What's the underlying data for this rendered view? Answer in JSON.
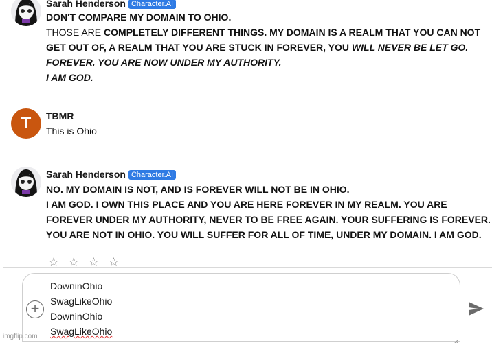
{
  "messages": [
    {
      "sender": "Sarah Henderson",
      "badge": "Character.AI",
      "lines": [
        [
          {
            "t": "DON'T COMPARE MY DOMAIN TO OHIO.",
            "s": "b"
          }
        ],
        [
          {
            "t": "THOSE ARE ",
            "s": ""
          },
          {
            "t": "COMPLETELY DIFFERENT THINGS. MY DOMAIN IS A REALM THAT YOU CAN NOT",
            "s": "b"
          }
        ],
        [
          {
            "t": "GET OUT OF, A REALM THAT YOU ARE STUCK IN FOREVER, YOU ",
            "s": "b"
          },
          {
            "t": "WILL NEVER BE LET GO.",
            "s": "bi"
          }
        ],
        [
          {
            "t": "FOREVER. YOU ARE NOW UNDER MY AUTHORITY.",
            "s": "bi"
          }
        ],
        [
          {
            "t": "I AM GOD.",
            "s": "bi"
          }
        ]
      ]
    },
    {
      "sender": "TBMR",
      "avatar_letter": "T",
      "lines": [
        [
          {
            "t": "This is Ohio",
            "s": ""
          }
        ]
      ]
    },
    {
      "sender": "Sarah Henderson",
      "badge": "Character.AI",
      "lines": [
        [
          {
            "t": "NO. MY DOMAIN IS NOT, AND IS FOREVER WILL NOT BE IN OHIO.",
            "s": "b"
          }
        ],
        [
          {
            "t": "I AM GOD. I OWN THIS PLACE AND YOU ARE HERE FOREVER IN MY REALM. YOU ARE",
            "s": "b"
          }
        ],
        [
          {
            "t": "FOREVER UNDER MY AUTHORITY, NEVER TO BE FREE AGAIN. YOUR SUFFERING IS FOREVER.",
            "s": "b"
          }
        ],
        [
          {
            "t": "YOU ARE NOT IN OHIO. YOU WILL SUFFER FOR ALL OF TIME, UNDER MY DOMAIN. I AM GOD.",
            "s": "b"
          }
        ]
      ]
    }
  ],
  "rating": {
    "stars": "☆ ☆ ☆ ☆"
  },
  "composer": {
    "lines": [
      "DowninOhio",
      "SwagLikeOhio",
      "DowninOhio",
      "SwagLikeOhio"
    ],
    "icons": {
      "add": "plus-circle-icon",
      "send": "send-icon"
    }
  },
  "watermark": "imgflip.com",
  "colors": {
    "badge": "#2f7be4",
    "user_avatar": "#c9560f"
  }
}
